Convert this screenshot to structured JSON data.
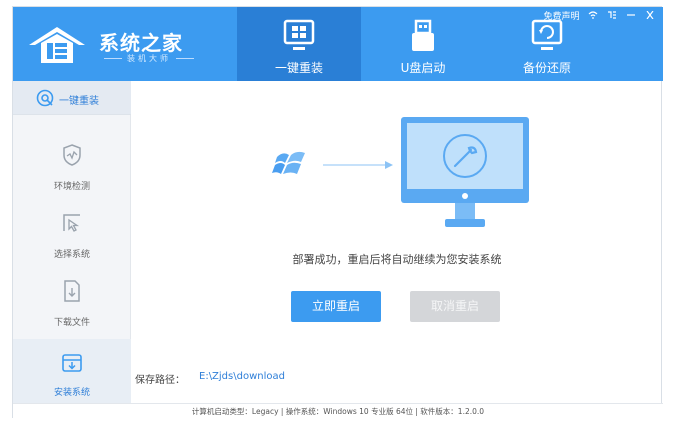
{
  "app": {
    "title": "系统之家",
    "subtitle": "装机大师"
  },
  "header": {
    "tabs": [
      {
        "label": "一键重装",
        "icon": "windows-monitor-icon",
        "active": true
      },
      {
        "label": "U盘启动",
        "icon": "usb-drive-icon",
        "active": false
      },
      {
        "label": "备份还原",
        "icon": "backup-restore-icon",
        "active": false
      }
    ],
    "topright": {
      "link": "免费声明",
      "controls": [
        "wifi-icon",
        "settings-icon",
        "minimize-icon",
        "close-icon"
      ]
    }
  },
  "sidebar": {
    "top": {
      "label": "一键重装",
      "icon": "reinstall-icon"
    },
    "items": [
      {
        "label": "环境检测",
        "icon": "shield-icon"
      },
      {
        "label": "选择系统",
        "icon": "cursor-select-icon"
      },
      {
        "label": "下载文件",
        "icon": "download-file-icon"
      },
      {
        "label": "安装系统",
        "icon": "install-box-icon",
        "active": true
      }
    ]
  },
  "main": {
    "status_text": "部署成功，重启后将自动继续为您安装系统",
    "restart_button": "立即重启",
    "cancel_button": "取消重启",
    "path_label": "保存路径：",
    "path_value": "E:\\Zjds\\download"
  },
  "footer": {
    "text": "计算机启动类型：Legacy | 操作系统：Windows 10 专业版 64位 | 软件版本：1.2.0.0"
  },
  "colors": {
    "primary": "#3c9bf0",
    "primary_dark": "#2a7fd6",
    "sidebar_bg": "#f3f5f8",
    "disabled": "#d4d6d9"
  }
}
